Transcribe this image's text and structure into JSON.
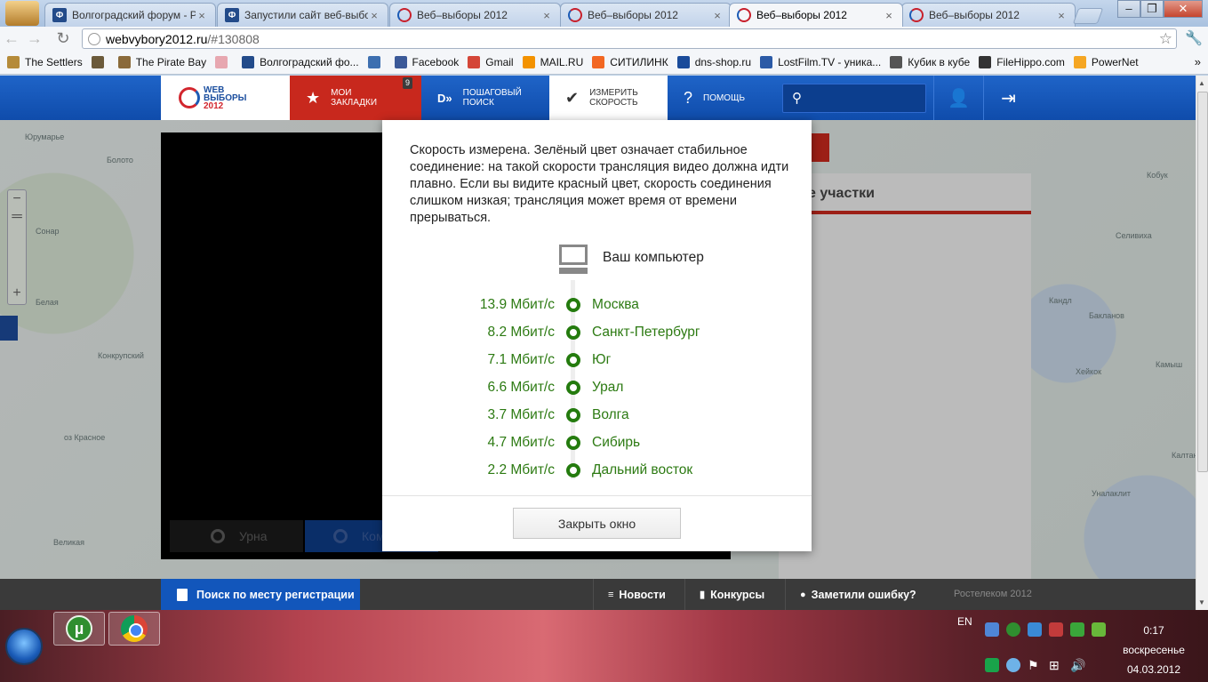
{
  "browser": {
    "tabs": [
      {
        "title": "Волгоградский форум - Р",
        "icon": "forum-icon",
        "active": false
      },
      {
        "title": "Запустили сайт веб-выбор",
        "icon": "forum-icon",
        "active": false
      },
      {
        "title": "Веб–выборы 2012",
        "icon": "webvybory-icon",
        "active": false
      },
      {
        "title": "Веб–выборы 2012",
        "icon": "webvybory-icon",
        "active": false
      },
      {
        "title": "Веб–выборы 2012",
        "icon": "webvybory-icon",
        "active": true
      },
      {
        "title": "Веб–выборы 2012",
        "icon": "webvybory-icon",
        "active": false
      }
    ],
    "tab_close": "×",
    "url_host": "webvybory2012.ru",
    "url_path": "/#130808",
    "bookmarks": [
      {
        "label": "The Settlers",
        "color": "#b58b3a"
      },
      {
        "label": "",
        "color": "#6b5a3a"
      },
      {
        "label": "The Pirate Bay",
        "color": "#8a6a3a"
      },
      {
        "label": "",
        "color": "#e7a7b0"
      },
      {
        "label": "Волгоградский фо...",
        "color": "#234b8a"
      },
      {
        "label": "",
        "color": "#3d6fb0"
      },
      {
        "label": "Facebook",
        "color": "#3b5998"
      },
      {
        "label": "Gmail",
        "color": "#d44638"
      },
      {
        "label": "MAIL.RU",
        "color": "#f39200"
      },
      {
        "label": "СИТИЛИНК",
        "color": "#f26722"
      },
      {
        "label": "dns-shop.ru",
        "color": "#1a4b9a"
      },
      {
        "label": "LostFilm.TV - уника...",
        "color": "#2b5aa6"
      },
      {
        "label": "Кубик в кубе",
        "color": "#555555"
      },
      {
        "label": "FileHippo.com",
        "color": "#333333"
      },
      {
        "label": "PowerNet",
        "color": "#f5a623"
      }
    ],
    "bookmarks_more": "»"
  },
  "site": {
    "logo": {
      "line1": "WEB",
      "line2": "ВЫБОРЫ",
      "line3": "2012"
    },
    "nav": {
      "bookmarks_line1": "Мои",
      "bookmarks_line2": "закладки",
      "bookmarks_badge": "9",
      "steps_line1": "Пошаговый",
      "steps_line2": "поиск",
      "speed_line1": "Измерить",
      "speed_line2": "скорость",
      "help": "Помощь"
    },
    "right_panel_title": "йшие участки",
    "video_tabs": {
      "urna": "Урна",
      "kom": "Ком"
    },
    "map_labels": [
      "Юрумарье",
      "Болото",
      "Белая",
      "Сонар",
      "Конкрупский",
      "оз Красное",
      "Великая",
      "Селивиха",
      "Кобук",
      "Кандл",
      "Хейкок",
      "Камыш",
      "Калтан",
      "Уналаклит",
      "Бакланов"
    ],
    "footer": {
      "register_search": "Поиск по месту регистрации",
      "news": "Новости",
      "contests": "Конкурсы",
      "report_error": "Заметили ошибку?",
      "copyright": "Ростелеком 2012"
    }
  },
  "modal": {
    "message": "Скорость измерена. Зелёный цвет означает стабильное соединение: на такой скорости трансляция видео должна идти плавно. Если вы видите красный цвет, скорость соединения слишком низкая; трансляция может время от времени прерываться.",
    "computer_label": "Ваш компьютер",
    "speeds": [
      {
        "value": "13.9 Мбит/с",
        "region": "Москва",
        "status": "green"
      },
      {
        "value": "8.2 Мбит/с",
        "region": "Санкт-Петербург",
        "status": "green"
      },
      {
        "value": "7.1 Мбит/с",
        "region": "Юг",
        "status": "green"
      },
      {
        "value": "6.6 Мбит/с",
        "region": "Урал",
        "status": "green"
      },
      {
        "value": "3.7 Мбит/с",
        "region": "Волга",
        "status": "green"
      },
      {
        "value": "4.7 Мбит/с",
        "region": "Сибирь",
        "status": "green"
      },
      {
        "value": "2.2 Мбит/с",
        "region": "Дальний восток",
        "status": "green"
      }
    ],
    "close_button": "Закрыть окно",
    "green_color": "#247b0e"
  },
  "taskbar": {
    "language": "EN",
    "time": "0:17",
    "day": "воскресенье",
    "date": "04.03.2012"
  }
}
